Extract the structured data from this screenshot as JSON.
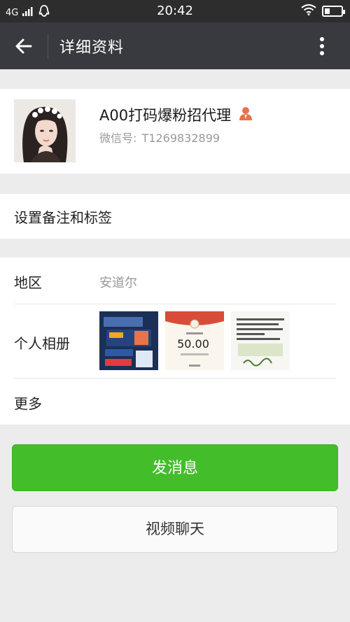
{
  "status_bar": {
    "network": "4G",
    "time": "20:42"
  },
  "app_bar": {
    "title": "详细资料"
  },
  "profile": {
    "name": "A00打码爆粉招代理",
    "wechat_id_label": "微信号:",
    "wechat_id": "T1269832899"
  },
  "remark_row": {
    "label": "设置备注和标签"
  },
  "info": {
    "region_label": "地区",
    "region_value": "安道尔",
    "album_label": "个人相册",
    "album_thumb2_amount": "50.00",
    "more_label": "更多"
  },
  "buttons": {
    "send_message": "发消息",
    "video_call": "视频聊天"
  },
  "colors": {
    "status_bar_bg": "#2d2d2d",
    "app_bar_bg": "#393a3f",
    "primary_green": "#44bd2b",
    "person_icon": "#e8734a"
  }
}
